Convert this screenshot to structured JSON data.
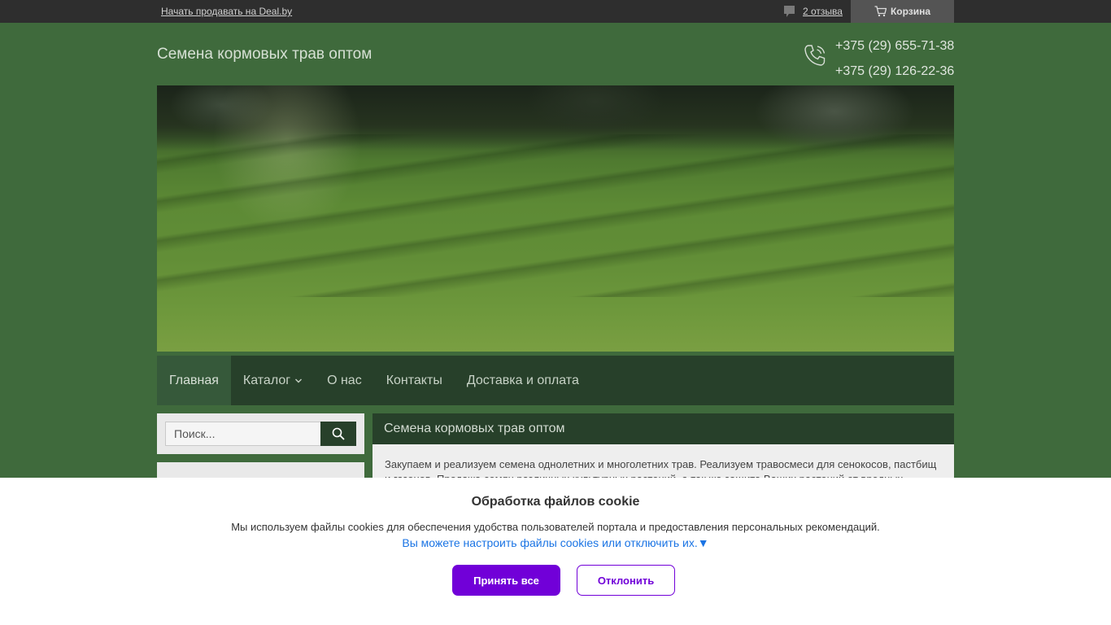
{
  "topbar": {
    "sell_link": "Начать продавать на Deal.by",
    "reviews_link": "2 отзыва",
    "cart_label": "Корзина",
    "icons": [
      "chat-icon",
      "cart-icon"
    ]
  },
  "header": {
    "site_title": "Семена кормовых трав оптом",
    "phones": [
      "+375 (29) 655-71-38",
      "+375 (29) 126-22-36"
    ],
    "phone_icon": "phone-icon"
  },
  "nav": {
    "items": [
      {
        "label": "Главная",
        "active": true
      },
      {
        "label": "Каталог",
        "has_dropdown": true
      },
      {
        "label": "О нас"
      },
      {
        "label": "Контакты"
      },
      {
        "label": "Доставка и оплата"
      }
    ]
  },
  "sidebar": {
    "search_placeholder": "Поиск...",
    "search_icon": "search-icon"
  },
  "main": {
    "heading": "Семена кормовых трав оптом",
    "intro": "Закупаем и реализуем семена однолетних и многолетних трав. Реализуем травосмеси для сенокосов, пастбищ и газонов. Продажа семян различных культурных растений, а так же защита Ваших растений от вредных"
  },
  "cookie": {
    "title": "Обработка файлов cookie",
    "text": "Мы используем файлы cookies для обеспечения удобства пользователей портала и предоставления персональных рекомендаций.",
    "settings_link": "Вы можете настроить файлы cookies или отключить их.▼",
    "accept_label": "Принять все",
    "decline_label": "Отклонить"
  },
  "colors": {
    "page_bg": "#3f6a3c",
    "nav_bg": "#27402a",
    "accent": "#7100d8",
    "link": "#1b74e4"
  }
}
